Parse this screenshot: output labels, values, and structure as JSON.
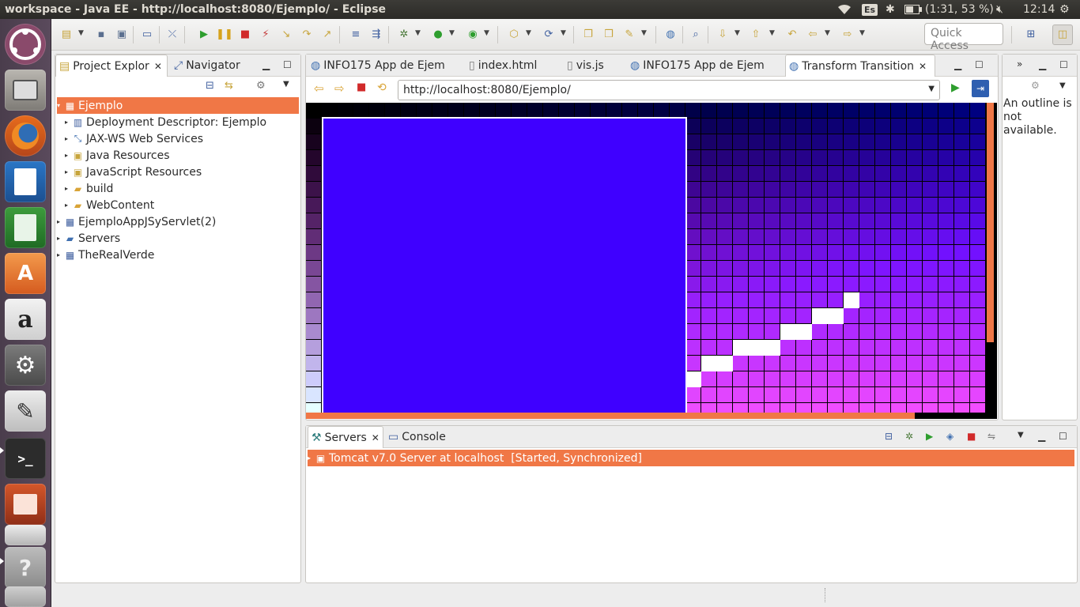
{
  "topbar": {
    "title": "workspace - Java EE - http://localhost:8080/Ejemplo/ - Eclipse",
    "keyboard": "Es",
    "battery": "(1:31, 53 %)",
    "clock": "12:14"
  },
  "quick_access": {
    "label": "Quick Access"
  },
  "project_explorer": {
    "tabs": [
      {
        "label": "Project Explor"
      },
      {
        "label": "Navigator"
      }
    ],
    "tree": [
      {
        "label": "Ejemplo",
        "icon": "project-icon",
        "selected": true
      },
      {
        "label": "Deployment Descriptor: Ejemplo",
        "icon": "descriptor-icon"
      },
      {
        "label": "JAX-WS Web Services",
        "icon": "webservice-icon"
      },
      {
        "label": "Java Resources",
        "icon": "java-resources-icon"
      },
      {
        "label": "JavaScript Resources",
        "icon": "js-resources-icon"
      },
      {
        "label": "build",
        "icon": "folder-icon"
      },
      {
        "label": "WebContent",
        "icon": "folder-icon"
      },
      {
        "label": "EjemploAppJSyServlet(2)",
        "icon": "project-icon"
      },
      {
        "label": "Servers",
        "icon": "folder-icon"
      },
      {
        "label": "TheRealVerde",
        "icon": "project-icon"
      }
    ]
  },
  "editor": {
    "tabs": [
      {
        "label": "INFO175 App de Ejem"
      },
      {
        "label": "index.html"
      },
      {
        "label": "vis.js"
      },
      {
        "label": "INFO175 App de Ejem"
      },
      {
        "label": "Transform Transition",
        "active": true
      }
    ],
    "url": "http://localhost:8080/Ejemplo/",
    "colors": {
      "rect": "#3f00ff",
      "accent": "#f07746"
    }
  },
  "outline": {
    "message": "An outline is not available."
  },
  "servers": {
    "tabs": [
      {
        "label": "Servers"
      },
      {
        "label": "Console"
      }
    ],
    "row": "Tomcat v7.0 Server at localhost  [Started, Synchronized]"
  }
}
